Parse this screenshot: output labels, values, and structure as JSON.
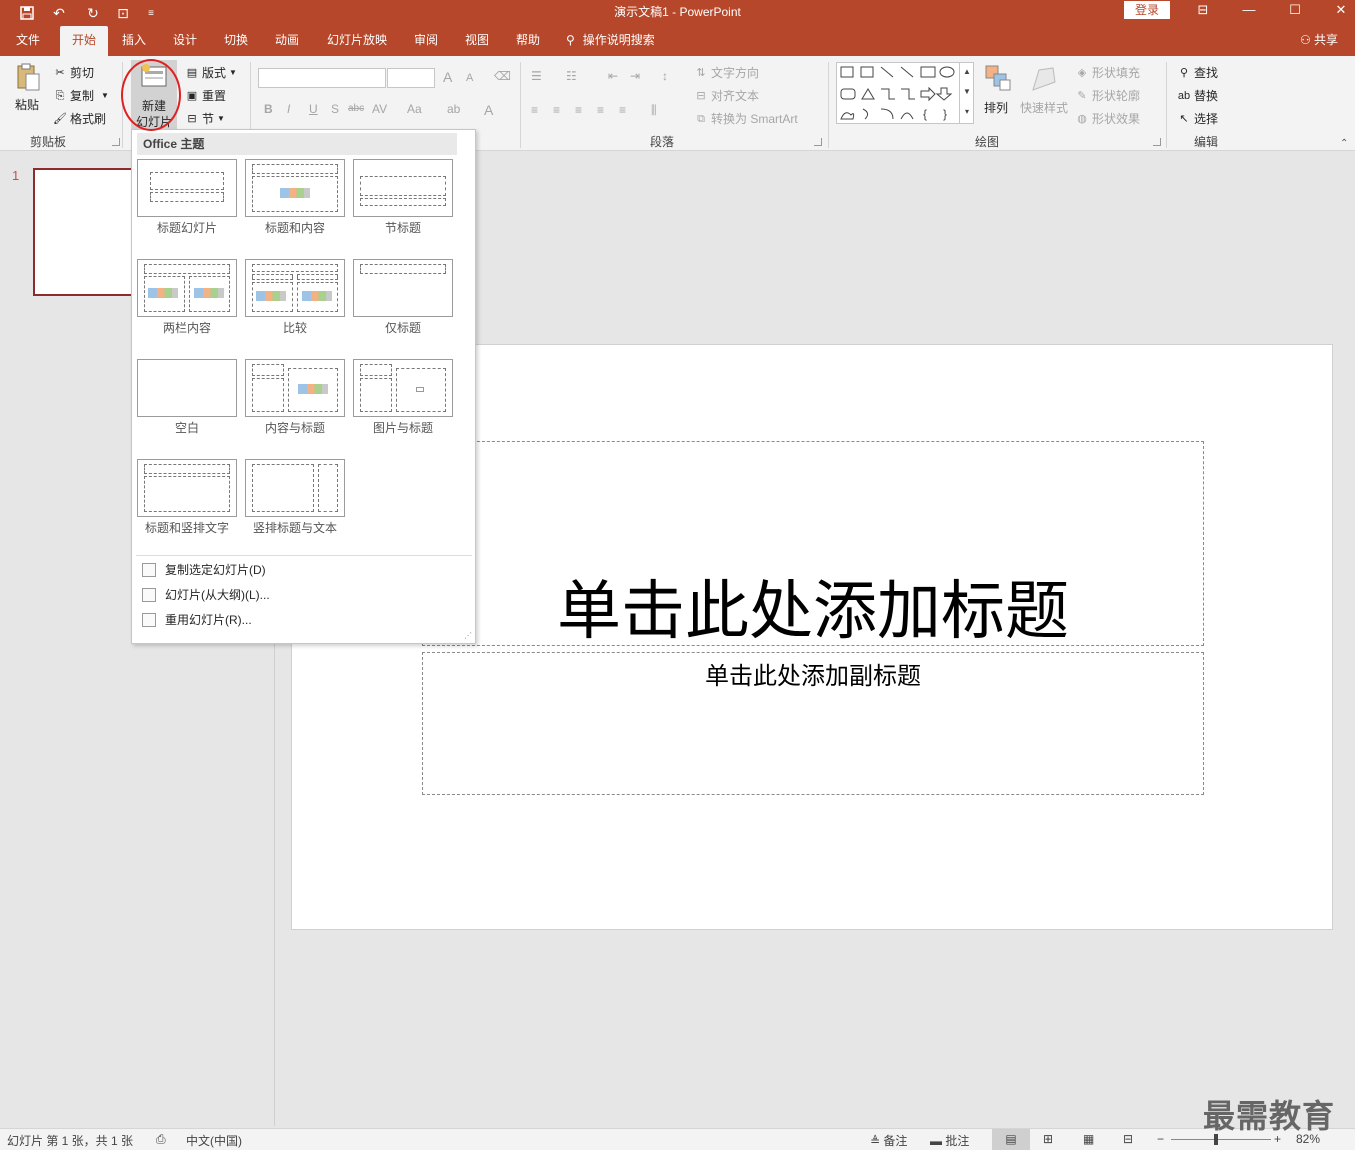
{
  "titlebar": {
    "doc_title": "演示文稿1  -  PowerPoint",
    "login": "登录",
    "qat": [
      {
        "name": "save-icon",
        "glyph": "🖫"
      },
      {
        "name": "undo-icon",
        "glyph": "↶"
      },
      {
        "name": "redo-icon",
        "glyph": "↻"
      },
      {
        "name": "slideshow-from-start-icon",
        "glyph": "⊡"
      },
      {
        "name": "customize-qat-icon",
        "glyph": "⌄"
      }
    ],
    "window_buttons": {
      "ribbon_display": "⊟",
      "minimize": "—",
      "maximize": "☐",
      "close": "✕"
    }
  },
  "tabs": [
    "文件",
    "开始",
    "插入",
    "设计",
    "切换",
    "动画",
    "幻灯片放映",
    "审阅",
    "视图",
    "帮助"
  ],
  "tell_me": "操作说明搜索",
  "share": "共享",
  "ribbon": {
    "clipboard": {
      "paste": "粘贴",
      "cut": "剪切",
      "copy": "复制",
      "format_painter": "格式刷",
      "label": "剪贴板"
    },
    "slides": {
      "new_slide_line1": "新建",
      "new_slide_line2": "幻灯片",
      "layout": "版式",
      "reset": "重置",
      "section": "节"
    },
    "font": {
      "bold": "B",
      "italic": "I",
      "underline": "U",
      "shadow": "S",
      "strike": "abc",
      "spacing": "AV",
      "case": "Aa",
      "grow": "A",
      "shrink": "A",
      "color": "A"
    },
    "paragraph": {
      "text_direction": "文字方向",
      "align_text": "对齐文本",
      "convert_smartart": "转换为 SmartArt",
      "label": "段落"
    },
    "drawing": {
      "arrange": "排列",
      "quick_styles": "快速样式",
      "shape_fill": "形状填充",
      "shape_outline": "形状轮廓",
      "shape_effects": "形状效果",
      "label": "绘图"
    },
    "editing": {
      "find": "查找",
      "replace": "替换",
      "select": "选择",
      "label": "编辑"
    }
  },
  "gallery": {
    "header": "Office 主题",
    "layouts": [
      "标题幻灯片",
      "标题和内容",
      "节标题",
      "两栏内容",
      "比较",
      "仅标题",
      "空白",
      "内容与标题",
      "图片与标题",
      "标题和竖排文字",
      "竖排标题与文本"
    ],
    "menu": [
      "复制选定幻灯片(D)",
      "幻灯片(从大纲)(L)...",
      "重用幻灯片(R)..."
    ]
  },
  "thumbnails": {
    "slide_number": "1"
  },
  "slide": {
    "title_placeholder": "单击此处添加标题",
    "subtitle_placeholder": "单击此处添加副标题"
  },
  "statusbar": {
    "slide_info": "幻灯片 第 1 张，共 1 张",
    "language": "中文(中国)",
    "notes": "备注",
    "comments": "批注",
    "zoom_minus": "−",
    "zoom_plus": "+",
    "zoom": "82%",
    "zoom_fraction": 0.82
  },
  "watermark": "最需教育",
  "colors": {
    "accent": "#b7472a",
    "selection_border": "#8e2c2c",
    "highlight_circle": "#e02020"
  }
}
